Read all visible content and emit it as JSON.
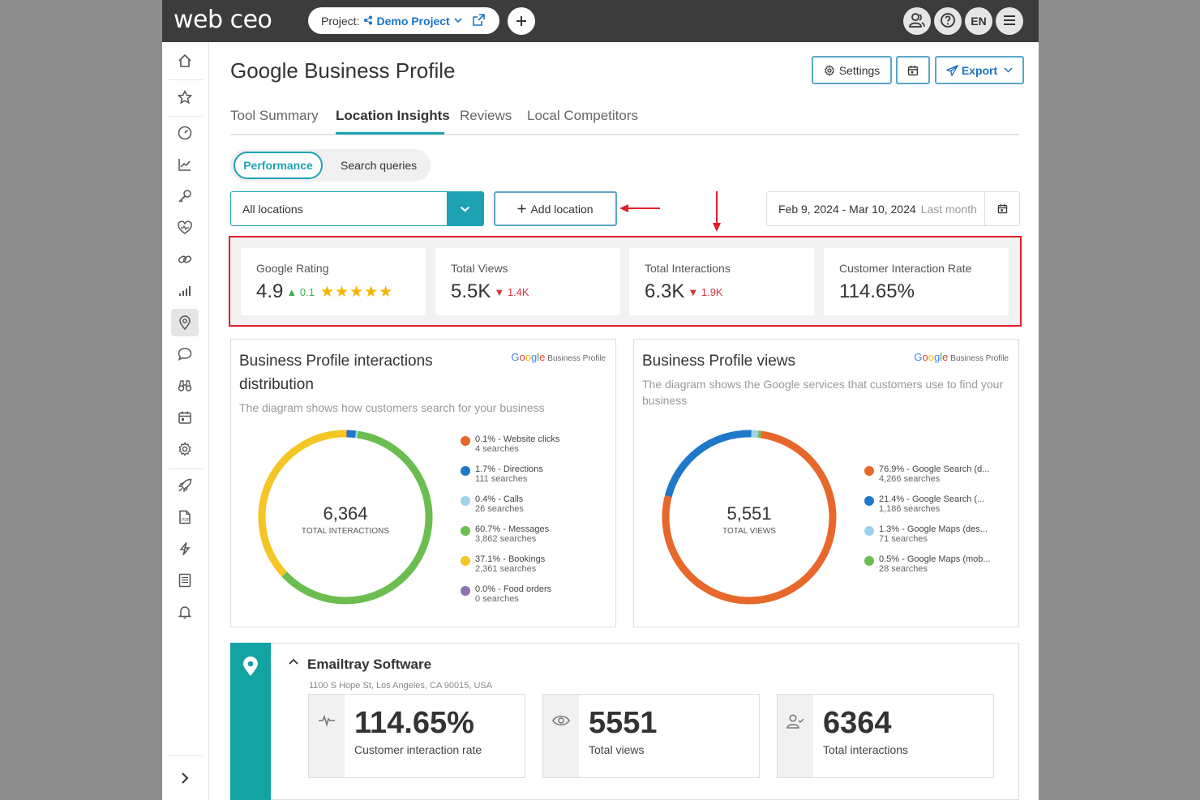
{
  "topbar": {
    "logo": "web ceo",
    "project_label": "Project:",
    "project_name": "Demo Project",
    "language": "EN"
  },
  "header": {
    "title": "Google Business Profile",
    "settings_label": "Settings",
    "export_label": "Export"
  },
  "tabs": [
    "Tool Summary",
    "Location Insights",
    "Reviews",
    "Local Competitors"
  ],
  "toggle": {
    "active": "Performance",
    "inactive": "Search queries"
  },
  "filters": {
    "location_value": "All locations",
    "add_location_label": "Add location",
    "date_range": "Feb 9, 2024 - Mar 10, 2024",
    "date_range_sub": "Last month"
  },
  "stats": [
    {
      "label": "Google Rating",
      "value": "4.9",
      "delta": "0.1",
      "direction": "up",
      "stars": "★★★★★"
    },
    {
      "label": "Total Views",
      "value": "5.5K",
      "delta": "1.4K",
      "direction": "down"
    },
    {
      "label": "Total Interactions",
      "value": "6.3K",
      "delta": "1.9K",
      "direction": "down"
    },
    {
      "label": "Customer Interaction Rate",
      "value": "114.65%"
    }
  ],
  "google_badge": {
    "brand": "Google",
    "product": "Business Profile"
  },
  "panels": {
    "interactions": {
      "title_line1": "Business Profile interactions",
      "title_line2": "distribution",
      "description": "The diagram shows how customers search for your business",
      "center_value": "6,364",
      "center_label": "TOTAL INTERACTIONS",
      "legend": [
        {
          "line1": "0.1% - Website clicks",
          "line2": "4 searches",
          "color": "#e8672a",
          "pct": 0.1
        },
        {
          "line1": "1.7% - Directions",
          "line2": "111 searches",
          "color": "#1f78c8",
          "pct": 1.7
        },
        {
          "line1": "0.4% - Calls",
          "line2": "26 searches",
          "color": "#9fd2ea",
          "pct": 0.4
        },
        {
          "line1": "60.7% - Messages",
          "line2": "3,862 searches",
          "color": "#6cbd4f",
          "pct": 60.7
        },
        {
          "line1": "37.1% - Bookings",
          "line2": "2,361 searches",
          "color": "#f3c623",
          "pct": 37.1
        },
        {
          "line1": "0.0% - Food orders",
          "line2": "0 searches",
          "color": "#8e74b0",
          "pct": 0.0
        }
      ]
    },
    "views": {
      "title": "Business Profile views",
      "description_line1": "The diagram shows the Google services that customers use to find your",
      "description_line2": "business",
      "center_value": "5,551",
      "center_label": "TOTAL VIEWS",
      "legend": [
        {
          "line1": "76.9% - Google Search (d...",
          "line2": "4,266 searches",
          "color": "#e8672a",
          "pct": 76.9
        },
        {
          "line1": "21.4% - Google Search (...",
          "line2": "1,186 searches",
          "color": "#1f78c8",
          "pct": 21.4
        },
        {
          "line1": "1.3% - Google Maps (des...",
          "line2": "71 searches",
          "color": "#9fd2ea",
          "pct": 1.3
        },
        {
          "line1": "0.5% - Google Maps (mob...",
          "line2": "28 searches",
          "color": "#6cbd4f",
          "pct": 0.5
        }
      ]
    }
  },
  "location": {
    "name": "Emailtray Software",
    "address": "1100 S Hope St, Los Angeles, CA 90015, USA",
    "metrics": [
      {
        "value": "114.65%",
        "caption": "Customer interaction rate",
        "icon": "pulse-icon"
      },
      {
        "value": "5551",
        "caption": "Total views",
        "icon": "eye-icon"
      },
      {
        "value": "6364",
        "caption": "Total interactions",
        "icon": "user-check-icon"
      }
    ]
  },
  "colors": {
    "accent": "#1da2b4",
    "highlight": "#e0202a",
    "topbar": "#3c3c3c"
  }
}
